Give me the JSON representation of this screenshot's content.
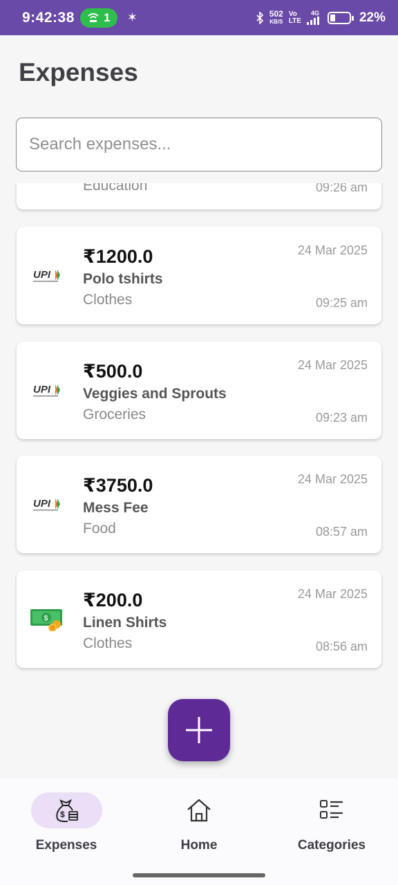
{
  "status_bar": {
    "time": "9:42:38",
    "hotspot_count": "1",
    "speed_value": "502",
    "speed_unit": "KB/S",
    "volte_top": "Vo",
    "volte_bottom": "LTE",
    "network": "4G",
    "battery": "22%",
    "battery_level": 0.22
  },
  "header": {
    "title": "Expenses"
  },
  "search": {
    "placeholder": "Search expenses..."
  },
  "partial_item": {
    "category": "Education",
    "time": "09:26 am"
  },
  "expenses": [
    {
      "amount": "₹1200.0",
      "title": "Polo tshirts",
      "category": "Clothes",
      "date": "24 Mar 2025",
      "time": "09:25 am",
      "icon": "upi-logo"
    },
    {
      "amount": "₹500.0",
      "title": "Veggies and Sprouts",
      "category": "Groceries",
      "date": "24 Mar 2025",
      "time": "09:23 am",
      "icon": "upi-logo"
    },
    {
      "amount": "₹3750.0",
      "title": "Mess Fee",
      "category": "Food",
      "date": "24 Mar 2025",
      "time": "08:57 am",
      "icon": "upi-logo"
    },
    {
      "amount": "₹200.0",
      "title": "Linen Shirts",
      "category": "Clothes",
      "date": "24 Mar 2025",
      "time": "08:56 am",
      "icon": "cash-icon"
    }
  ],
  "nav": {
    "expenses": "Expenses",
    "home": "Home",
    "categories": "Categories"
  },
  "colors": {
    "status_bar": "#6a4aa8",
    "accent": "#5e2a96",
    "active_nav_pill": "#eadff6"
  }
}
